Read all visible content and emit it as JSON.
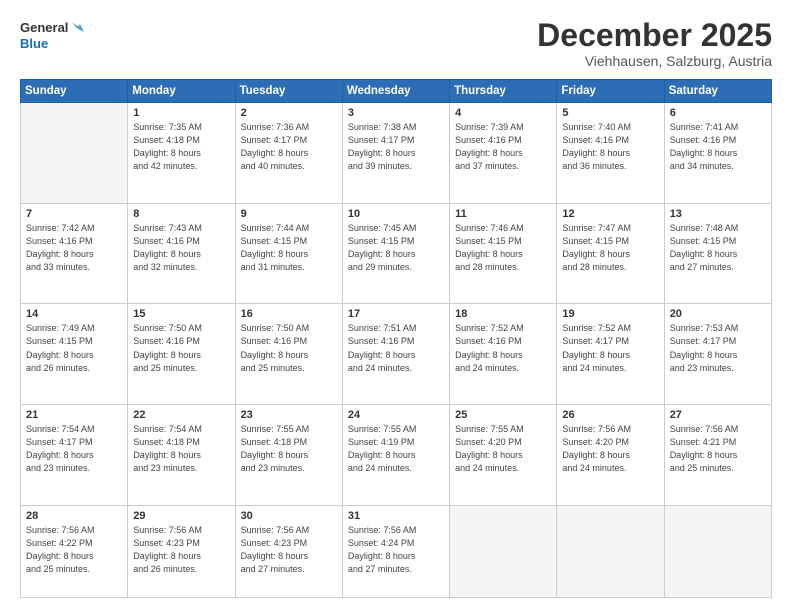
{
  "logo": {
    "line1": "General",
    "line2": "Blue"
  },
  "title": "December 2025",
  "location": "Viehhausen, Salzburg, Austria",
  "days_of_week": [
    "Sunday",
    "Monday",
    "Tuesday",
    "Wednesday",
    "Thursday",
    "Friday",
    "Saturday"
  ],
  "weeks": [
    [
      {
        "day": "",
        "info": ""
      },
      {
        "day": "1",
        "info": "Sunrise: 7:35 AM\nSunset: 4:18 PM\nDaylight: 8 hours\nand 42 minutes."
      },
      {
        "day": "2",
        "info": "Sunrise: 7:36 AM\nSunset: 4:17 PM\nDaylight: 8 hours\nand 40 minutes."
      },
      {
        "day": "3",
        "info": "Sunrise: 7:38 AM\nSunset: 4:17 PM\nDaylight: 8 hours\nand 39 minutes."
      },
      {
        "day": "4",
        "info": "Sunrise: 7:39 AM\nSunset: 4:16 PM\nDaylight: 8 hours\nand 37 minutes."
      },
      {
        "day": "5",
        "info": "Sunrise: 7:40 AM\nSunset: 4:16 PM\nDaylight: 8 hours\nand 36 minutes."
      },
      {
        "day": "6",
        "info": "Sunrise: 7:41 AM\nSunset: 4:16 PM\nDaylight: 8 hours\nand 34 minutes."
      }
    ],
    [
      {
        "day": "7",
        "info": "Sunrise: 7:42 AM\nSunset: 4:16 PM\nDaylight: 8 hours\nand 33 minutes."
      },
      {
        "day": "8",
        "info": "Sunrise: 7:43 AM\nSunset: 4:16 PM\nDaylight: 8 hours\nand 32 minutes."
      },
      {
        "day": "9",
        "info": "Sunrise: 7:44 AM\nSunset: 4:15 PM\nDaylight: 8 hours\nand 31 minutes."
      },
      {
        "day": "10",
        "info": "Sunrise: 7:45 AM\nSunset: 4:15 PM\nDaylight: 8 hours\nand 29 minutes."
      },
      {
        "day": "11",
        "info": "Sunrise: 7:46 AM\nSunset: 4:15 PM\nDaylight: 8 hours\nand 28 minutes."
      },
      {
        "day": "12",
        "info": "Sunrise: 7:47 AM\nSunset: 4:15 PM\nDaylight: 8 hours\nand 28 minutes."
      },
      {
        "day": "13",
        "info": "Sunrise: 7:48 AM\nSunset: 4:15 PM\nDaylight: 8 hours\nand 27 minutes."
      }
    ],
    [
      {
        "day": "14",
        "info": "Sunrise: 7:49 AM\nSunset: 4:15 PM\nDaylight: 8 hours\nand 26 minutes."
      },
      {
        "day": "15",
        "info": "Sunrise: 7:50 AM\nSunset: 4:16 PM\nDaylight: 8 hours\nand 25 minutes."
      },
      {
        "day": "16",
        "info": "Sunrise: 7:50 AM\nSunset: 4:16 PM\nDaylight: 8 hours\nand 25 minutes."
      },
      {
        "day": "17",
        "info": "Sunrise: 7:51 AM\nSunset: 4:16 PM\nDaylight: 8 hours\nand 24 minutes."
      },
      {
        "day": "18",
        "info": "Sunrise: 7:52 AM\nSunset: 4:16 PM\nDaylight: 8 hours\nand 24 minutes."
      },
      {
        "day": "19",
        "info": "Sunrise: 7:52 AM\nSunset: 4:17 PM\nDaylight: 8 hours\nand 24 minutes."
      },
      {
        "day": "20",
        "info": "Sunrise: 7:53 AM\nSunset: 4:17 PM\nDaylight: 8 hours\nand 23 minutes."
      }
    ],
    [
      {
        "day": "21",
        "info": "Sunrise: 7:54 AM\nSunset: 4:17 PM\nDaylight: 8 hours\nand 23 minutes."
      },
      {
        "day": "22",
        "info": "Sunrise: 7:54 AM\nSunset: 4:18 PM\nDaylight: 8 hours\nand 23 minutes."
      },
      {
        "day": "23",
        "info": "Sunrise: 7:55 AM\nSunset: 4:18 PM\nDaylight: 8 hours\nand 23 minutes."
      },
      {
        "day": "24",
        "info": "Sunrise: 7:55 AM\nSunset: 4:19 PM\nDaylight: 8 hours\nand 24 minutes."
      },
      {
        "day": "25",
        "info": "Sunrise: 7:55 AM\nSunset: 4:20 PM\nDaylight: 8 hours\nand 24 minutes."
      },
      {
        "day": "26",
        "info": "Sunrise: 7:56 AM\nSunset: 4:20 PM\nDaylight: 8 hours\nand 24 minutes."
      },
      {
        "day": "27",
        "info": "Sunrise: 7:56 AM\nSunset: 4:21 PM\nDaylight: 8 hours\nand 25 minutes."
      }
    ],
    [
      {
        "day": "28",
        "info": "Sunrise: 7:56 AM\nSunset: 4:22 PM\nDaylight: 8 hours\nand 25 minutes."
      },
      {
        "day": "29",
        "info": "Sunrise: 7:56 AM\nSunset: 4:23 PM\nDaylight: 8 hours\nand 26 minutes."
      },
      {
        "day": "30",
        "info": "Sunrise: 7:56 AM\nSunset: 4:23 PM\nDaylight: 8 hours\nand 27 minutes."
      },
      {
        "day": "31",
        "info": "Sunrise: 7:56 AM\nSunset: 4:24 PM\nDaylight: 8 hours\nand 27 minutes."
      },
      {
        "day": "",
        "info": ""
      },
      {
        "day": "",
        "info": ""
      },
      {
        "day": "",
        "info": ""
      }
    ]
  ]
}
